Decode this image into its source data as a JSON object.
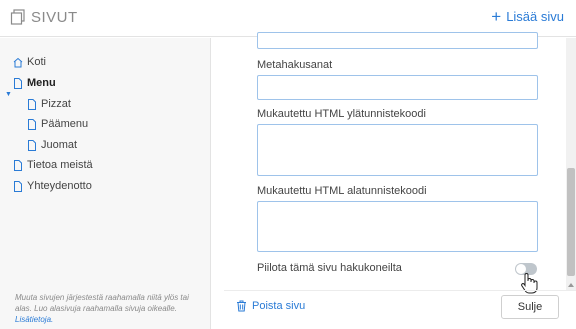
{
  "header": {
    "title": "SIVUT",
    "add_page_label": "Lisää sivu",
    "add_icon": "plus-icon",
    "logo_icon": "pages-icon"
  },
  "sidebar": {
    "items": [
      {
        "label": "Koti",
        "icon": "home-icon",
        "level": 0,
        "bold": false
      },
      {
        "label": "Menu",
        "icon": "page-icon",
        "level": 0,
        "bold": true,
        "expanded": true
      },
      {
        "label": "Pizzat",
        "icon": "page-icon",
        "level": 1,
        "bold": false
      },
      {
        "label": "Päämenu",
        "icon": "page-icon",
        "level": 1,
        "bold": false
      },
      {
        "label": "Juomat",
        "icon": "page-icon",
        "level": 1,
        "bold": false
      },
      {
        "label": "Tietoa meistä",
        "icon": "page-icon",
        "level": 0,
        "bold": false
      },
      {
        "label": "Yhteydenotto",
        "icon": "page-icon",
        "level": 0,
        "bold": false
      }
    ],
    "help_text": "Muuta sivujen järjestestä raahamalla niitä ylös tai alas. Luo alasivuja raahamalla sivuja oikealle.",
    "help_link": "Lisätietoja."
  },
  "form": {
    "meta_keywords_label": "Metahakusanat",
    "meta_keywords_value": "",
    "custom_header_label": "Mukautettu HTML ylätunnistekoodi",
    "custom_header_value": "",
    "custom_footer_label": "Mukautettu HTML alatunnistekoodi",
    "custom_footer_value": "",
    "hide_from_search_label": "Piilota tämä sivu hakukoneilta",
    "hide_from_search_on": false
  },
  "footer": {
    "delete_label": "Poista sivu",
    "delete_icon": "trash-icon",
    "close_label": "Sulje"
  },
  "colors": {
    "accent": "#2a7bd6",
    "input_border": "#9ec3ea",
    "toggle_off": "#bfc6cc"
  }
}
